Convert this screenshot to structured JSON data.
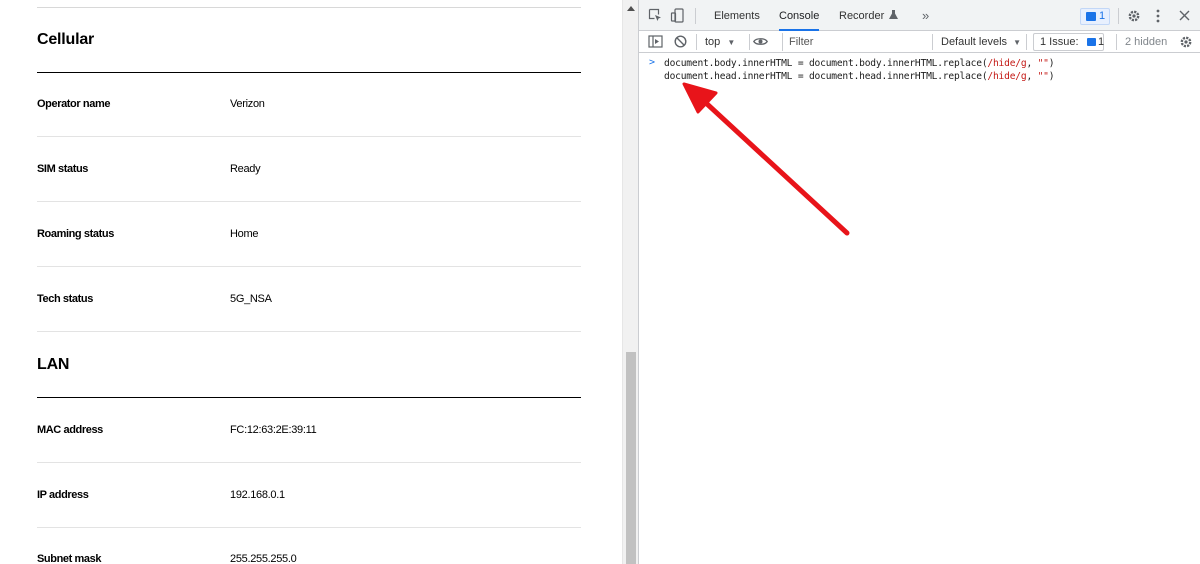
{
  "page": {
    "sections": [
      {
        "title": "Cellular",
        "rows": [
          {
            "label": "Operator name",
            "value": "Verizon"
          },
          {
            "label": "SIM status",
            "value": "Ready"
          },
          {
            "label": "Roaming status",
            "value": "Home"
          },
          {
            "label": "Tech status",
            "value": "5G_NSA"
          }
        ]
      },
      {
        "title": "LAN",
        "rows": [
          {
            "label": "MAC address",
            "value": "FC:12:63:2E:39:11"
          },
          {
            "label": "IP address",
            "value": "192.168.0.1"
          },
          {
            "label": "Subnet mask",
            "value": "255.255.255.0"
          }
        ]
      }
    ]
  },
  "devtools": {
    "tabs": [
      {
        "label": "Elements"
      },
      {
        "label": "Console"
      },
      {
        "label": "Recorder"
      }
    ],
    "active_tab": "Console",
    "more_tabs": "»",
    "messages_badge": "1",
    "toolbar": {
      "context": "top",
      "filter_placeholder": "Filter",
      "levels": "Default levels",
      "issues_label": "1 Issue:",
      "issues_count": "1",
      "hidden": "2 hidden"
    },
    "console": {
      "prompt": ">",
      "line1": {
        "pre": "document.body.innerHTML = document.body.innerHTML.replace(",
        "re": "/hide/g",
        "mid": ", ",
        "str": "\"\"",
        "post": ")"
      },
      "line2": {
        "pre": "document.head.innerHTML = document.head.innerHTML.replace(",
        "re": "/hide/g",
        "mid": ", ",
        "str": "\"\"",
        "post": ")"
      }
    },
    "accent_color": "#1a73e8",
    "annotation_color": "#e8141a"
  }
}
